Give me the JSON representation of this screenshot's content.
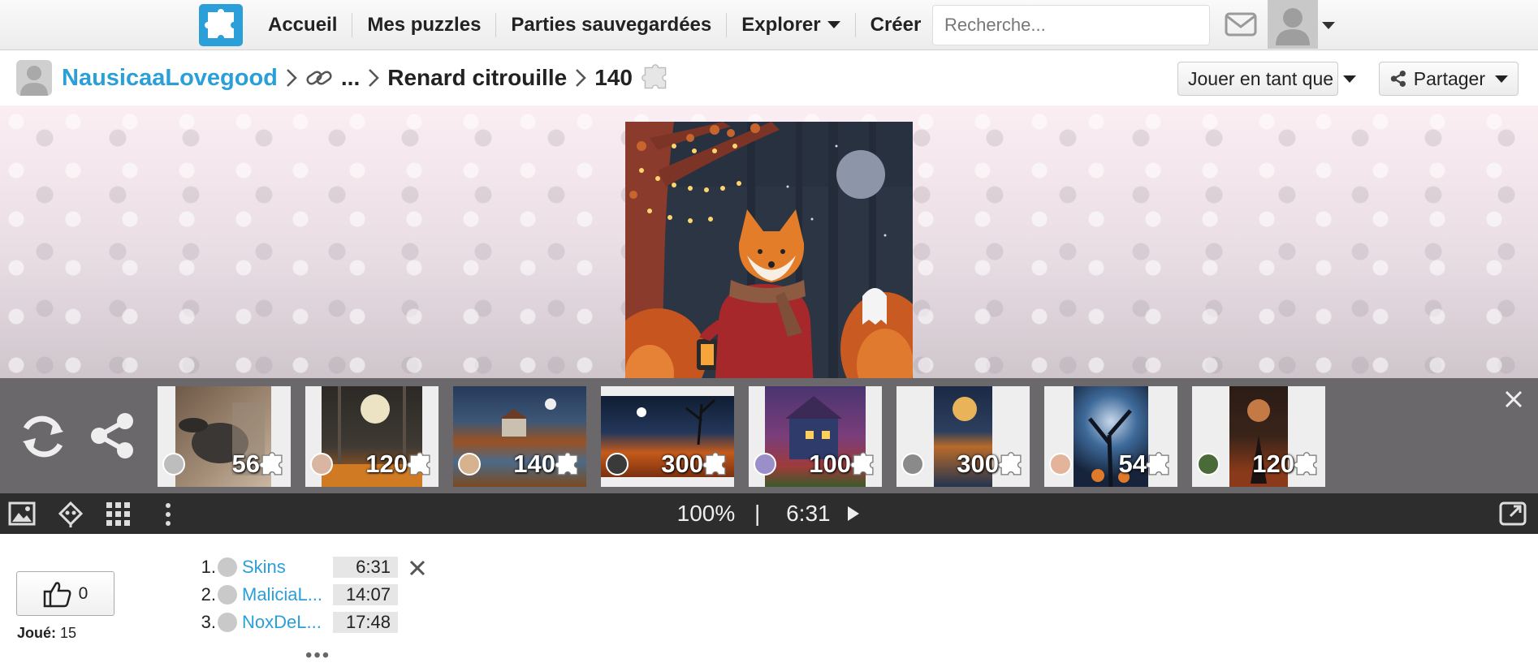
{
  "nav": {
    "links": [
      {
        "label": "Accueil"
      },
      {
        "label": "Mes puzzles"
      },
      {
        "label": "Parties sauvegardées"
      },
      {
        "label": "Explorer"
      },
      {
        "label": "Créer"
      }
    ],
    "search_placeholder": "Recherche...",
    "icons": [
      "puzzle-logo-icon",
      "mail-icon",
      "user-avatar-icon",
      "chevron-down-icon"
    ],
    "logo_color": "#2a9fd8"
  },
  "breadcrumb": {
    "user": "NausicaaLovegood",
    "ellipsis": "...",
    "title": "Renard citrouille",
    "pieces": "140",
    "play_as": "Jouer en tant que",
    "share": "Partager"
  },
  "strip": {
    "thumbnails": [
      {
        "pieces": "56",
        "scene": "mole"
      },
      {
        "pieces": "120",
        "scene": "moon-forest"
      },
      {
        "pieces": "140",
        "scene": "autumn-river"
      },
      {
        "pieces": "300",
        "scene": "pumpkin-field"
      },
      {
        "pieces": "100",
        "scene": "haunted-house"
      },
      {
        "pieces": "300",
        "scene": "moon-lake"
      },
      {
        "pieces": "54",
        "scene": "spooky-tree"
      },
      {
        "pieces": "120",
        "scene": "witch-moon"
      }
    ]
  },
  "toolbar": {
    "zoom": "100%",
    "separator": "|",
    "time": "6:31"
  },
  "likes": {
    "count": "0"
  },
  "played": {
    "label": "Joué:",
    "value": "15"
  },
  "leaderboard": [
    {
      "rank": "1.",
      "name": "Skins",
      "time": "6:31"
    },
    {
      "rank": "2.",
      "name": "MaliciaL...",
      "time": "14:07"
    },
    {
      "rank": "3.",
      "name": "NoxDeL...",
      "time": "17:48"
    }
  ],
  "leaderboard_more": "•••"
}
